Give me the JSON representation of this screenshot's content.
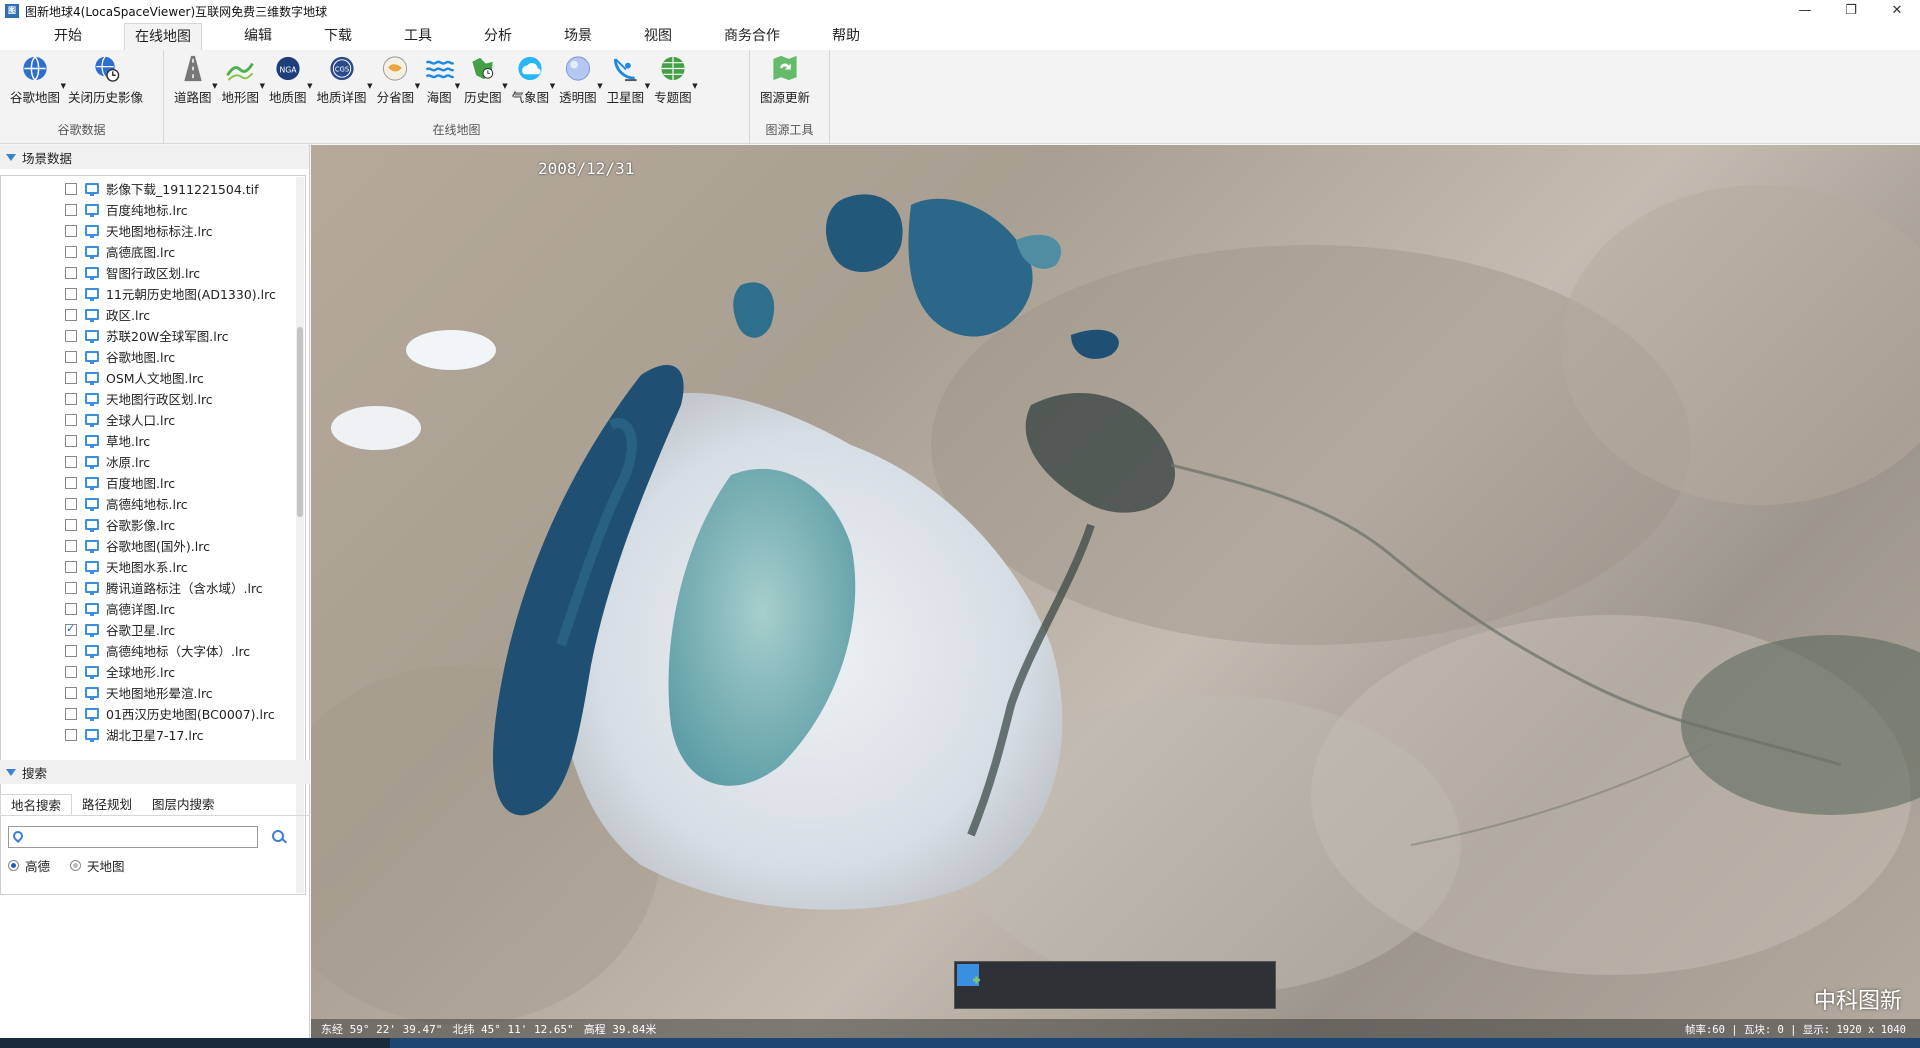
{
  "window": {
    "title": "图新地球4(LocaSpaceViewer)互联网免费三维数字地球",
    "icon_text": "图",
    "controls": [
      "—",
      "❐",
      "✕"
    ]
  },
  "menu": [
    "开始",
    "在线地图",
    "编辑",
    "下载",
    "工具",
    "分析",
    "场景",
    "视图",
    "商务合作",
    "帮助"
  ],
  "menu_active_index": 1,
  "ribbon": {
    "groups": [
      {
        "label": "谷歌数据",
        "items": [
          {
            "label": "谷歌地图",
            "icon": "google-globe-icon",
            "caret": true
          },
          {
            "label": "关闭历史影像",
            "icon": "history-imagery-icon",
            "caret": false
          }
        ]
      },
      {
        "label": "在线地图",
        "items": [
          {
            "label": "道路图",
            "icon": "road-map-icon",
            "caret": true
          },
          {
            "label": "地形图",
            "icon": "terrain-map-icon",
            "caret": true
          },
          {
            "label": "地质图",
            "icon": "nga-geology-icon",
            "caret": true
          },
          {
            "label": "地质详图",
            "icon": "cgs-geology-detail-icon",
            "caret": true
          },
          {
            "label": "分省图",
            "icon": "province-map-icon",
            "caret": true
          },
          {
            "label": "海图",
            "icon": "sea-chart-icon",
            "caret": true
          },
          {
            "label": "历史图",
            "icon": "history-map-icon",
            "caret": true
          },
          {
            "label": "气象图",
            "icon": "weather-map-icon",
            "caret": true
          },
          {
            "label": "透明图",
            "icon": "transparent-map-icon",
            "caret": true
          },
          {
            "label": "卫星图",
            "icon": "satellite-map-icon",
            "caret": true
          },
          {
            "label": "专题图",
            "icon": "thematic-map-icon",
            "caret": true
          }
        ]
      },
      {
        "label": "图源工具",
        "items": [
          {
            "label": "图源更新",
            "icon": "source-update-icon",
            "caret": false
          }
        ]
      }
    ]
  },
  "scene_panel": {
    "title": "场景数据",
    "layers": [
      {
        "name": "影像下载_1911221504.tif",
        "checked": false
      },
      {
        "name": "百度纯地标.lrc",
        "checked": false
      },
      {
        "name": "天地图地标标注.lrc",
        "checked": false
      },
      {
        "name": "高德底图.lrc",
        "checked": false
      },
      {
        "name": "智图行政区划.lrc",
        "checked": false
      },
      {
        "name": "11元朝历史地图(AD1330).lrc",
        "checked": false
      },
      {
        "name": "政区.lrc",
        "checked": false
      },
      {
        "name": "苏联20W全球军图.lrc",
        "checked": false
      },
      {
        "name": "谷歌地图.lrc",
        "checked": false
      },
      {
        "name": "OSM人文地图.lrc",
        "checked": false
      },
      {
        "name": "天地图行政区划.lrc",
        "checked": false
      },
      {
        "name": "全球人口.lrc",
        "checked": false
      },
      {
        "name": "草地.lrc",
        "checked": false
      },
      {
        "name": "冰原.lrc",
        "checked": false
      },
      {
        "name": "百度地图.lrc",
        "checked": false
      },
      {
        "name": "高德纯地标.lrc",
        "checked": false
      },
      {
        "name": "谷歌影像.lrc",
        "checked": false
      },
      {
        "name": "谷歌地图(国外).lrc",
        "checked": false
      },
      {
        "name": "天地图水系.lrc",
        "checked": false
      },
      {
        "name": "腾讯道路标注（含水域）.lrc",
        "checked": false
      },
      {
        "name": "高德详图.lrc",
        "checked": false
      },
      {
        "name": "谷歌卫星.lrc",
        "checked": true
      },
      {
        "name": "高德纯地标（大字体）.lrc",
        "checked": false
      },
      {
        "name": "全球地形.lrc",
        "checked": false
      },
      {
        "name": "天地图地形晕渲.lrc",
        "checked": false
      },
      {
        "name": "01西汉历史地图(BC0007).lrc",
        "checked": false
      },
      {
        "name": "湖北卫星7-17.lrc",
        "checked": false
      }
    ]
  },
  "search_panel": {
    "title": "搜索",
    "tabs": [
      "地名搜索",
      "路径规划",
      "图层内搜索"
    ],
    "active_tab": 0,
    "input_value": "",
    "input_placeholder": "",
    "providers": [
      {
        "label": "高德",
        "selected": true
      },
      {
        "label": "天地图",
        "selected": false
      }
    ]
  },
  "map": {
    "date_label": "2008/12/31",
    "watermark": "中科图新",
    "status": {
      "longitude": "东经 59° 22' 39.47\"",
      "latitude": "北纬 45° 11' 12.65\"",
      "elevation": "高程 39.84米",
      "right_text": "帧率:60 | 瓦块: 0 | 显示: 1920 x 1040"
    },
    "tools": [
      "pan-hand-icon",
      "select-arrow-icon",
      "place-marker-icon",
      "draw-line-icon",
      "draw-polygon-icon",
      "measure-chart-icon"
    ]
  },
  "colors": {
    "accent": "#3a7fd5",
    "water_dark": "#1f4f72",
    "water_light": "#7fb6b8",
    "toolbar_bg": "#2f3136"
  }
}
